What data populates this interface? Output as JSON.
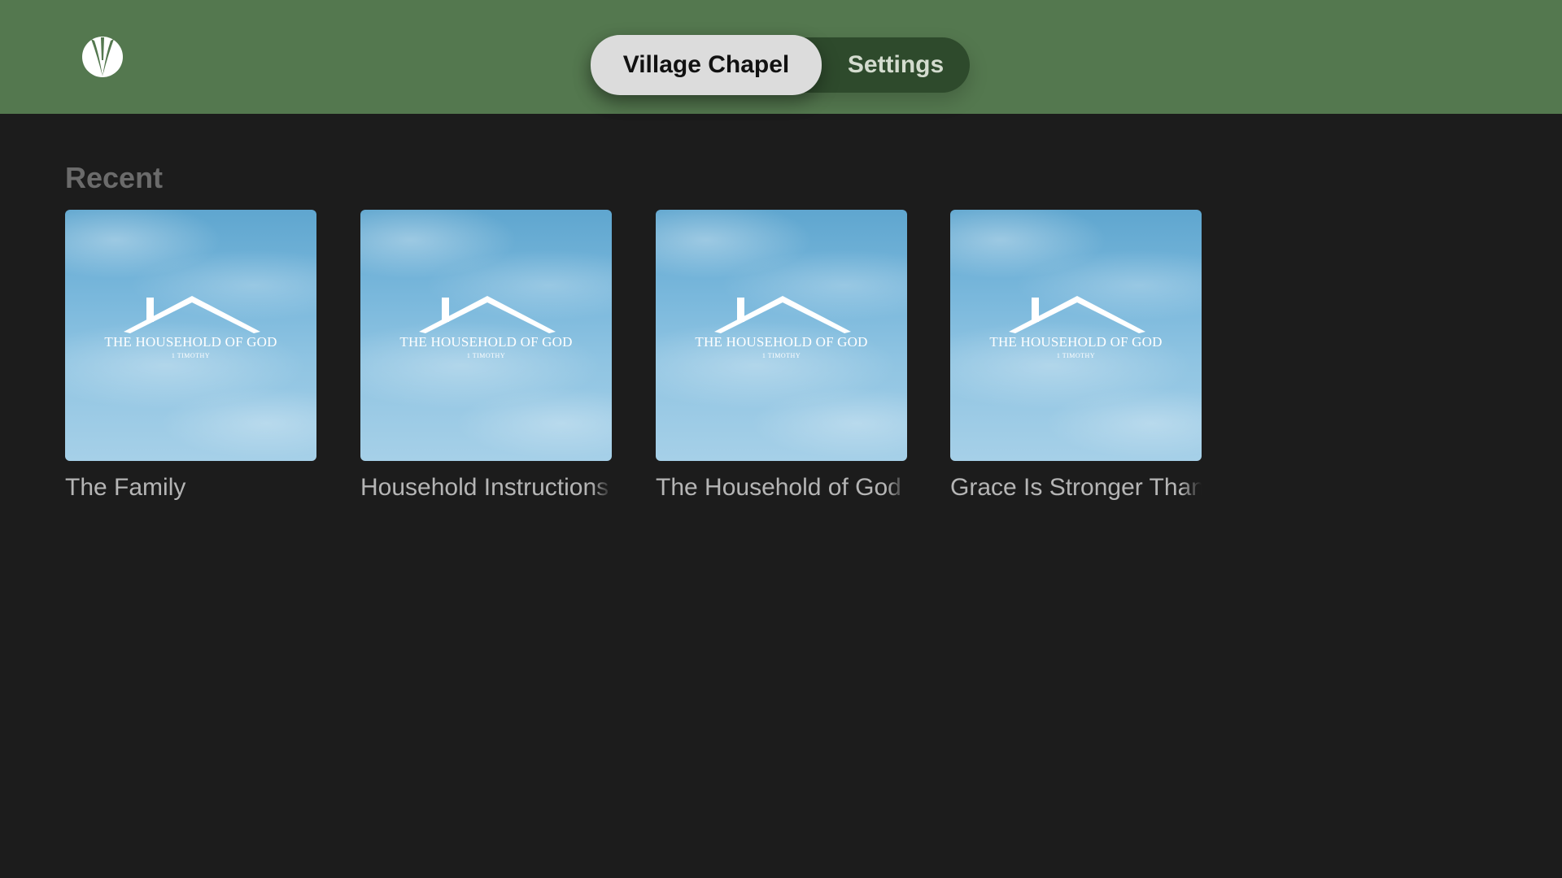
{
  "nav": {
    "logo_icon": "v-logo-icon",
    "tabs": [
      {
        "label": "Village Chapel",
        "active": true
      },
      {
        "label": "Settings",
        "active": false
      }
    ]
  },
  "recent": {
    "title": "Recent",
    "items": [
      {
        "label": "The Family",
        "art_title": "THE HOUSEHOLD OF GOD",
        "art_subtitle": "1 TIMOTHY"
      },
      {
        "label": "Household Instructions",
        "art_title": "THE HOUSEHOLD OF GOD",
        "art_subtitle": "1 TIMOTHY"
      },
      {
        "label": "The Household of God",
        "art_title": "THE HOUSEHOLD OF GOD",
        "art_subtitle": "1 TIMOTHY"
      },
      {
        "label": "Grace Is Stronger Than",
        "art_title": "THE HOUSEHOLD OF GOD",
        "art_subtitle": "1 TIMOTHY"
      }
    ]
  },
  "colors": {
    "header_bg": "#54784f",
    "page_bg": "#1c1c1c",
    "tab_active_bg": "#dcdcdc",
    "tab_bar_bg": "#2e4a2c"
  }
}
